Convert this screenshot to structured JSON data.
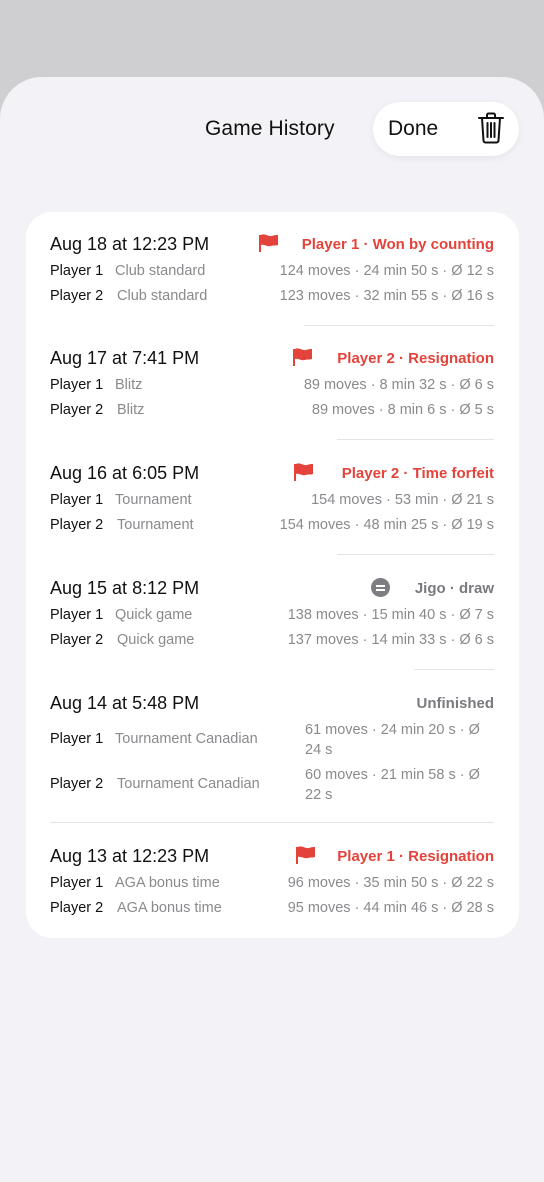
{
  "header": {
    "title": "Game History",
    "done_label": "Done"
  },
  "games": [
    {
      "date": "Aug 18 at 12:23 PM",
      "result": "Player 1 · Won by counting",
      "result_icon": "flag-icon",
      "p1": {
        "name": "Player 1",
        "clock": "Club standard",
        "stats": "124 moves · 24 min 50 s · Ø 12 s"
      },
      "p2": {
        "name": "Player 2",
        "clock": "Club standard",
        "stats": "123 moves · 32 min 55 s · Ø 16 s"
      }
    },
    {
      "date": "Aug 17 at 7:41 PM",
      "result": "Player 2 · Resignation",
      "result_icon": "flag-icon",
      "p1": {
        "name": "Player 1",
        "clock": "Blitz",
        "stats": "89 moves · 8 min 32 s · Ø 6 s"
      },
      "p2": {
        "name": "Player 2",
        "clock": "Blitz",
        "stats": "89 moves · 8 min 6 s · Ø 5 s"
      }
    },
    {
      "date": "Aug 16 at 6:05 PM",
      "result": "Player 2 · Time forfeit",
      "result_icon": "flag-icon",
      "p1": {
        "name": "Player 1",
        "clock": "Tournament",
        "stats": "154 moves · 53 min · Ø 21 s"
      },
      "p2": {
        "name": "Player 2",
        "clock": "Tournament",
        "stats": "154 moves · 48 min 25 s · Ø 19 s"
      }
    },
    {
      "date": "Aug 15 at 8:12 PM",
      "result": "Jigo · draw",
      "result_icon": "equals-circle-icon",
      "p1": {
        "name": "Player 1",
        "clock": "Quick game",
        "stats": "138 moves · 15 min 40 s · Ø 7 s"
      },
      "p2": {
        "name": "Player 2",
        "clock": "Quick game",
        "stats": "137 moves · 14 min 33 s · Ø 6 s"
      }
    },
    {
      "date": "Aug 14 at 5:48 PM",
      "result": "Unfinished",
      "result_icon": "",
      "p1": {
        "name": "Player 1",
        "clock": "Tournament Canadian",
        "stats": "61 moves · 24 min 20 s · Ø 24 s"
      },
      "p2": {
        "name": "Player 2",
        "clock": "Tournament Canadian",
        "stats": "60 moves · 21 min 58 s · Ø 22 s"
      }
    },
    {
      "date": "Aug 13 at 12:23 PM",
      "result": "Player 1 · Resignation",
      "result_icon": "flag-icon",
      "p1": {
        "name": "Player 1",
        "clock": "AGA bonus time",
        "stats": "96 moves · 35 min 50 s · Ø 22 s"
      },
      "p2": {
        "name": "Player 2",
        "clock": "AGA bonus time",
        "stats": "95 moves · 44 min 46 s · Ø 28 s"
      }
    }
  ],
  "colors": {
    "accent_red": "#e3433a",
    "neutral_gray": "#7a7a7f"
  }
}
